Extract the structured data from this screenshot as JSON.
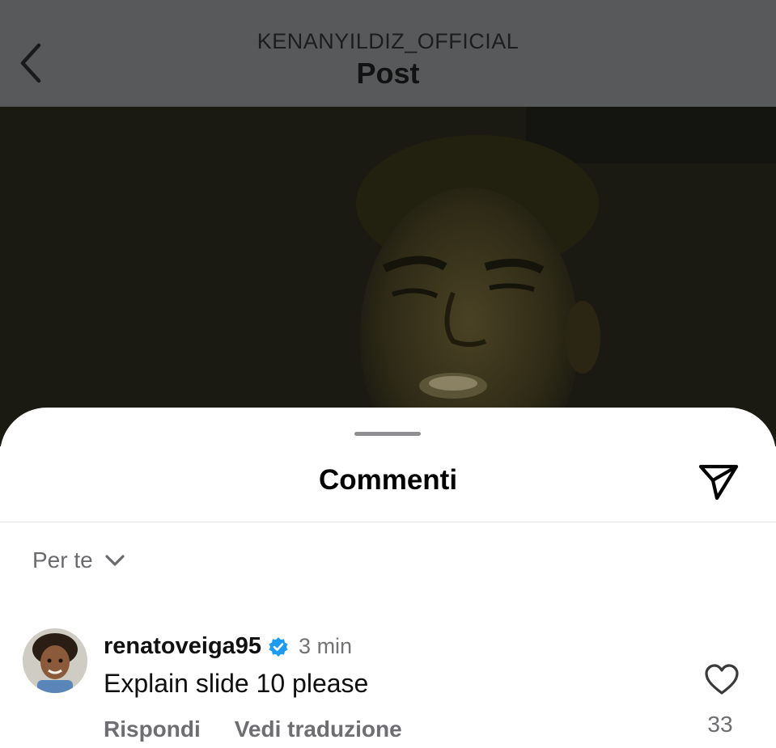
{
  "header": {
    "account": "KENANYILDIZ_OFFICIAL",
    "title": "Post",
    "back_icon": "chevron-left-icon"
  },
  "sheet": {
    "title": "Commenti",
    "share_icon": "paper-plane-icon",
    "sort": {
      "label": "Per te",
      "icon": "chevron-down-icon"
    }
  },
  "comments": [
    {
      "username": "renatoveiga95",
      "verified": true,
      "time": "3 min",
      "text": "Explain slide 10 please",
      "reply_label": "Rispondi",
      "translate_label": "Vedi traduzione",
      "likes": "33"
    }
  ],
  "colors": {
    "verified_blue": "#1d9bf0",
    "header_dim": "#58595b",
    "secondary_text": "#6d6d72"
  }
}
